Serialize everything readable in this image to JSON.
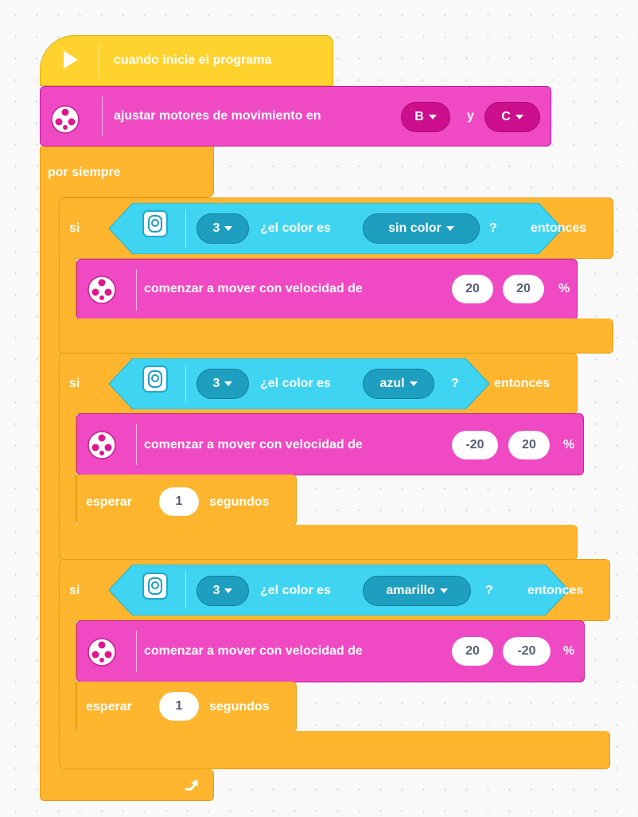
{
  "colors": {
    "events": "#ffd22e",
    "control": "#ffb62e",
    "motors": "#f049c4",
    "sensors": "#3fd5f2",
    "dropdown_pink": "#cd0f8e",
    "dropdown_blue": "#1e9fbf"
  },
  "hat": {
    "icon": "play-icon",
    "label": "cuando inicie el programa"
  },
  "setup": {
    "icon": "motor-pair-icon",
    "label": "ajustar motores de movimiento en",
    "port1": "B",
    "conjunction": "y",
    "port2": "C"
  },
  "forever": {
    "label": "por siempre",
    "loop_icon": "loop-arrow-icon"
  },
  "if_blocks": [
    {
      "si": "si",
      "sensor_icon": "color-sensor-icon",
      "port": "3",
      "question": "¿el color es",
      "color": "sin color",
      "qmark": "?",
      "then": "entonces",
      "move": {
        "icon": "motor-pair-icon",
        "label": "comenzar a mover con velocidad de",
        "speed_left": "20",
        "speed_right": "20",
        "unit": "%"
      }
    },
    {
      "si": "si",
      "sensor_icon": "color-sensor-icon",
      "port": "3",
      "question": "¿el color es",
      "color": "azul",
      "qmark": "?",
      "then": "entonces",
      "move": {
        "icon": "motor-pair-icon",
        "label": "comenzar a mover con velocidad de",
        "speed_left": "-20",
        "speed_right": "20",
        "unit": "%"
      },
      "wait": {
        "label": "esperar",
        "value": "1",
        "unit": "segundos"
      }
    },
    {
      "si": "si",
      "sensor_icon": "color-sensor-icon",
      "port": "3",
      "question": "¿el color es",
      "color": "amarillo",
      "qmark": "?",
      "then": "entonces",
      "move": {
        "icon": "motor-pair-icon",
        "label": "comenzar a mover con velocidad de",
        "speed_left": "20",
        "speed_right": "-20",
        "unit": "%"
      },
      "wait": {
        "label": "esperar",
        "value": "1",
        "unit": "segundos"
      }
    }
  ]
}
